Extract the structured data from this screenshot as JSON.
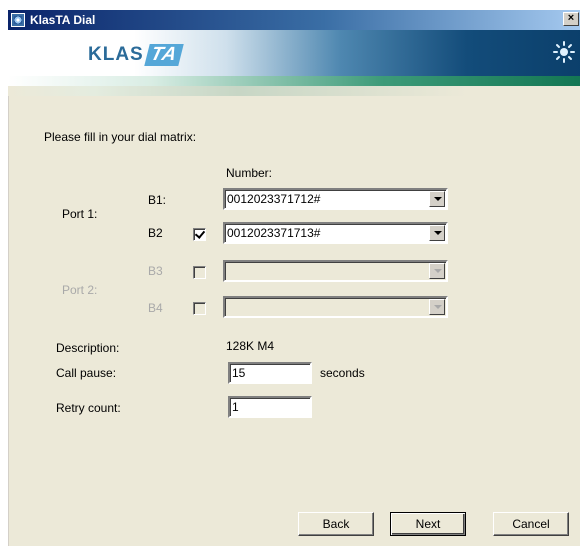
{
  "window": {
    "title": "KlasTA Dial",
    "close_label": "×"
  },
  "banner": {
    "logo_text": "KLAS",
    "logo_accent": "TA"
  },
  "main": {
    "instruction": "Please fill in your dial matrix:",
    "number_header": "Number:",
    "ports": [
      {
        "label": "Port 1:",
        "enabled": true,
        "channels": [
          {
            "label": "B1:",
            "has_checkbox": false,
            "number": "0012023371712#"
          },
          {
            "label": "B2",
            "has_checkbox": true,
            "checked": true,
            "number": "0012023371713#"
          }
        ]
      },
      {
        "label": "Port 2:",
        "enabled": false,
        "channels": [
          {
            "label": "B3",
            "has_checkbox": true,
            "checked": false,
            "number": ""
          },
          {
            "label": "B4",
            "has_checkbox": true,
            "checked": false,
            "number": ""
          }
        ]
      }
    ],
    "description": {
      "label": "Description:",
      "value": "128K M4"
    },
    "call_pause": {
      "label": "Call pause:",
      "value": "15",
      "unit": "seconds"
    },
    "retry_count": {
      "label": "Retry count:",
      "value": "1"
    }
  },
  "footer": {
    "back_label": "Back",
    "next_label": "Next",
    "cancel_label": "Cancel"
  }
}
